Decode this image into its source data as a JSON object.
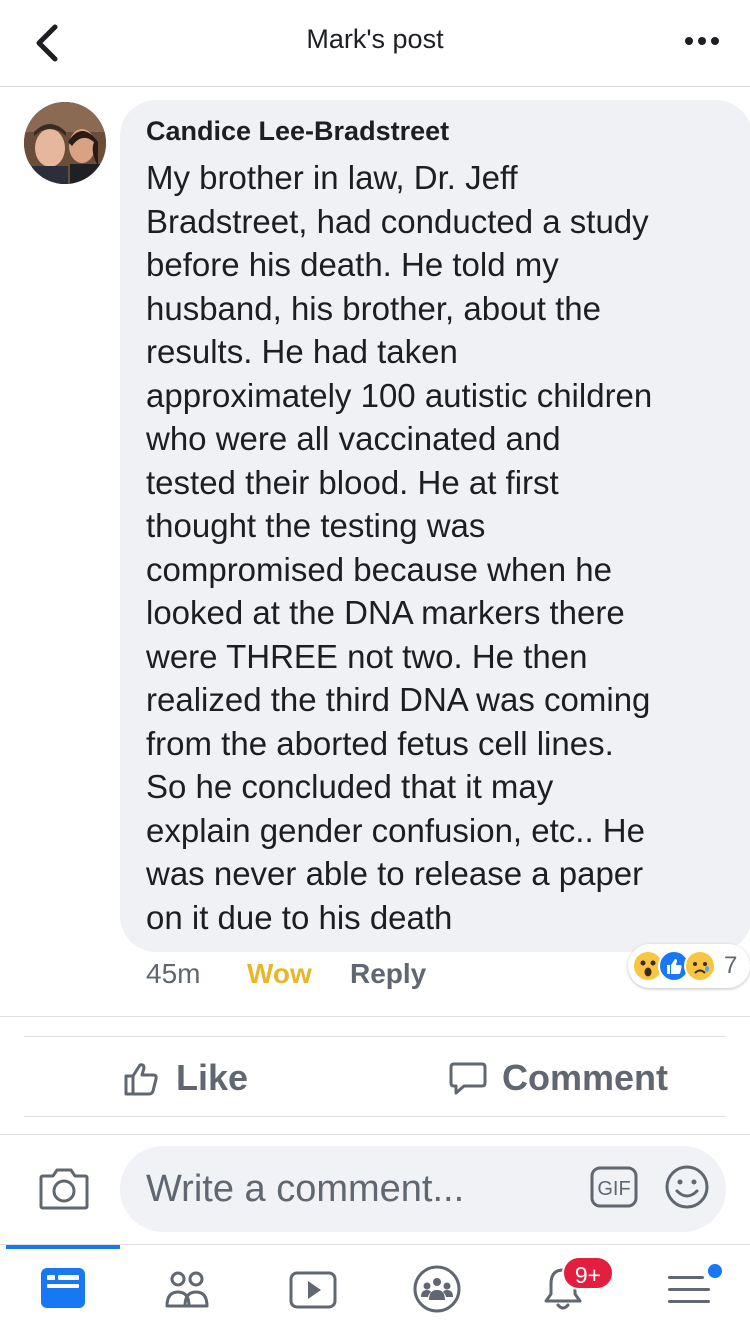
{
  "header": {
    "title": "Mark's post"
  },
  "comment": {
    "author": "Candice Lee-Bradstreet",
    "text": "My brother in law, Dr. Jeff\nBradstreet, had conducted a study\nbefore his death. He told my\nhusband, his brother, about the\nresults. He had taken\napproximately 100 autistic children\nwho were all vaccinated and\ntested their blood. He at first\nthought the testing was\ncompromised because when he\nlooked at the DNA markers there\nwere THREE not two.  He then\nrealized the third DNA was coming\nfrom the aborted fetus cell lines.\nSo he concluded that it may\nexplain gender confusion, etc.. He\nwas never able to release a paper\non it due to his death",
    "time": "45m",
    "reaction_label": "Wow",
    "reply_label": "Reply",
    "reaction_count": "7",
    "reaction_icons": [
      "wow-icon",
      "like-icon",
      "sad-icon"
    ]
  },
  "actions": {
    "like_label": "Like",
    "comment_label": "Comment"
  },
  "composer": {
    "placeholder": "Write a comment...",
    "gif_label": "GIF"
  },
  "nav": {
    "items": [
      "news-feed-icon",
      "friends-icon",
      "watch-icon",
      "groups-icon",
      "notifications-icon",
      "menu-icon"
    ],
    "notification_badge": "9+",
    "active_color": "#1877f2"
  },
  "colors": {
    "wow_accent": "#e8b62b",
    "bubble_bg": "#eff1f4",
    "badge_red": "#e41e3f"
  }
}
